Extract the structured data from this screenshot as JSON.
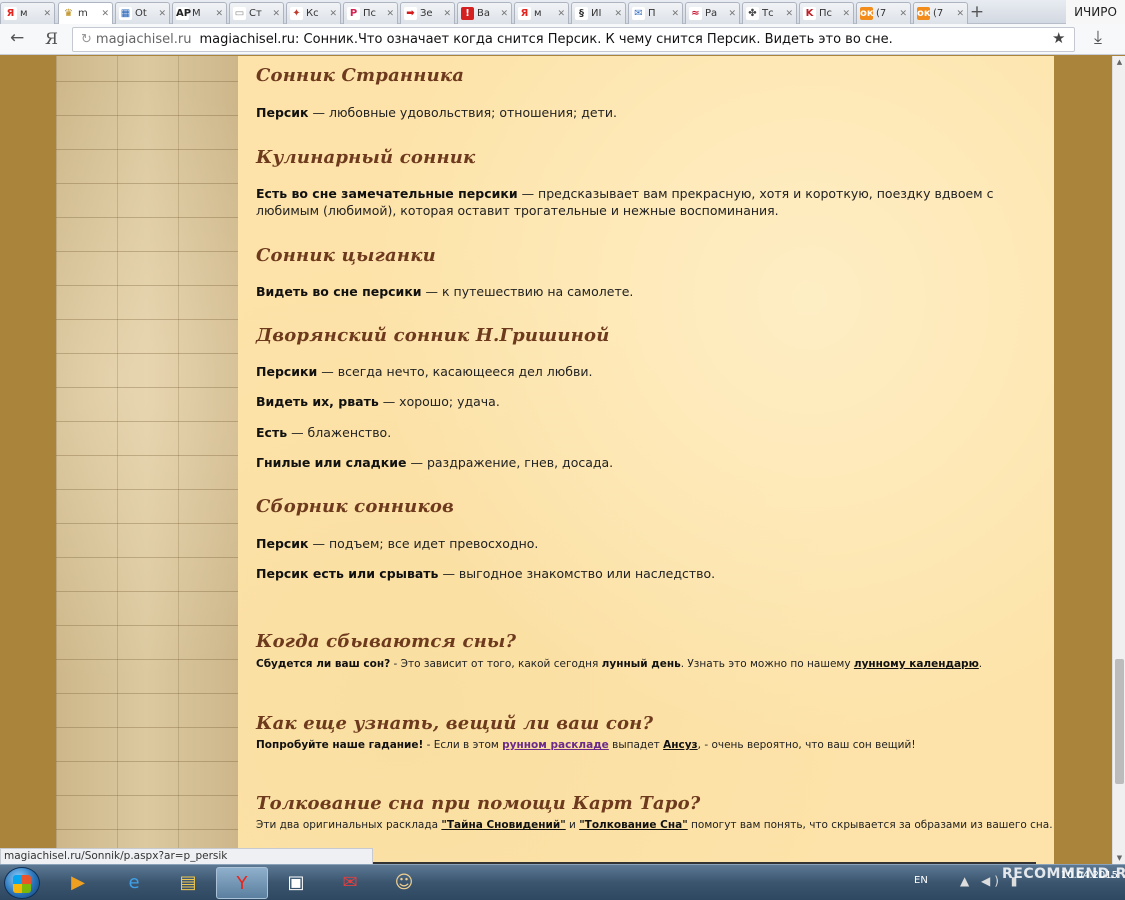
{
  "browser": {
    "tabs": [
      {
        "icon": "Я",
        "icon_bg": "#ffffff",
        "icon_color": "#e52620",
        "label": "м",
        "active": false
      },
      {
        "icon": "♛",
        "icon_bg": "#ffffff",
        "icon_color": "#b8860b",
        "label": "m",
        "active": true
      },
      {
        "icon": "▦",
        "icon_bg": "#ffffff",
        "icon_color": "#1f5fb5",
        "label": "Ot",
        "active": false
      },
      {
        "icon": "AP",
        "icon_bg": "#ffffff",
        "icon_color": "#222222",
        "label": "M",
        "active": false
      },
      {
        "icon": "▭",
        "icon_bg": "#ffffff",
        "icon_color": "#888888",
        "label": "Ст",
        "active": false
      },
      {
        "icon": "✦",
        "icon_bg": "#ffffff",
        "icon_color": "#c0392b",
        "label": "Кс",
        "active": false
      },
      {
        "icon": "P",
        "icon_bg": "#ffffff",
        "icon_color": "#d62050",
        "label": "Пс",
        "active": false
      },
      {
        "icon": "➡",
        "icon_bg": "#ffffff",
        "icon_color": "#d41a1a",
        "label": "Зе",
        "active": false
      },
      {
        "icon": "!",
        "icon_bg": "#d42020",
        "icon_color": "#ffffff",
        "label": "Ва",
        "active": false
      },
      {
        "icon": "Я",
        "icon_bg": "#ffffff",
        "icon_color": "#e52620",
        "label": "м",
        "active": false
      },
      {
        "icon": "§",
        "icon_bg": "#ffffff",
        "icon_color": "#333333",
        "label": "ИІ",
        "active": false
      },
      {
        "icon": "✉",
        "icon_bg": "#ffffff",
        "icon_color": "#3a73c4",
        "label": "П",
        "active": false
      },
      {
        "icon": "≈",
        "icon_bg": "#ffffff",
        "icon_color": "#c8102e",
        "label": "Ра",
        "active": false
      },
      {
        "icon": "✤",
        "icon_bg": "#ffffff",
        "icon_color": "#444444",
        "label": "Тс",
        "active": false
      },
      {
        "icon": "K",
        "icon_bg": "#ffffff",
        "icon_color": "#c0202a",
        "label": "Пс",
        "active": false
      },
      {
        "icon": "ок",
        "icon_bg": "#f28c1b",
        "icon_color": "#ffffff",
        "label": "(7",
        "active": false
      },
      {
        "icon": "ок",
        "icon_bg": "#f28c1b",
        "icon_color": "#ffffff",
        "label": "(7",
        "active": false
      }
    ],
    "new_tab": "+",
    "profile_label": "ИЧИРО",
    "back_icon": "←",
    "yandex_icon": "Я",
    "address": {
      "domain": "magiachisel.ru",
      "page_title": "magiachisel.ru: Сонник.Что означает когда снится Персик. К чему снится Персик. Видеть это во сне."
    },
    "star_icon": "★",
    "download_icon": "⤓",
    "status_url": "magiachisel.ru/Sonnik/p.aspx?ar=p_persik"
  },
  "sections": [
    {
      "title": "Сонник Странника",
      "entries": [
        {
          "term": "Персик",
          "text": " — любовные удовольствия; отношения; дети."
        }
      ]
    },
    {
      "title": "Кулинарный сонник",
      "entries": [
        {
          "term": "Есть во сне замечательные персики",
          "text": " — предсказывает вам прекрасную, хотя и короткую, поездку вдвоем с любимым (любимой), которая оставит трогательные и нежные воспоминания."
        }
      ]
    },
    {
      "title": "Сонник цыганки",
      "entries": [
        {
          "term": "Видеть во сне персики",
          "text": " — к путешествию на самолете."
        }
      ]
    },
    {
      "title": "Дворянский сонник Н.Гришиной",
      "entries": [
        {
          "term": "Персики",
          "text": " — всегда нечто, касающееся дел любви."
        },
        {
          "term": "Видеть их, рвать",
          "text": " — хорошо; удача."
        },
        {
          "term": "Есть",
          "text": " — блаженство."
        },
        {
          "term": "Гнилые или сладкие",
          "text": " — раздражение, гнев, досада."
        }
      ]
    },
    {
      "title": "Сборник сонников",
      "entries": [
        {
          "term": "Персик",
          "text": " — подъем; все идет превосходно."
        },
        {
          "term": "Персик есть или срывать",
          "text": " — выгодное знакомство или наследство."
        }
      ]
    }
  ],
  "promos": [
    {
      "title": "Когда сбываются сны?",
      "lead": "Сбудется ли ваш сон?",
      "t1": " - Это зависит от того, какой сегодня ",
      "bold": "лунный день",
      "t2": ". Узнать это можно по нашему ",
      "link": "лунному календарю",
      "t3": "."
    },
    {
      "title": "Как еще узнать, вещий ли ваш сон?",
      "lead": "Попробуйте наше гадание!",
      "t1": " - Если в этом ",
      "link1": "рунном раскладе",
      "t2": " выпадет ",
      "link2": "Ансуз",
      "t3": ", - очень вероятно, что ваш сон вещий!"
    },
    {
      "title": "Толкование сна при помощи Карт Таро?",
      "t1": "Эти два оригинальных расклада ",
      "link1": "\"Тайна Сновидений\"",
      "t2": " и ",
      "link2": "\"Толкование Сна\"",
      "t3": " помогут вам понять, что скрывается за образами из вашего сна."
    }
  ],
  "taskbar": {
    "apps": [
      {
        "icon": "▶",
        "color": "#f0a020"
      },
      {
        "icon": "e",
        "color": "#3fa0e8"
      },
      {
        "icon": "▤",
        "color": "#f0c850"
      },
      {
        "icon": "Y",
        "color": "#e52620"
      },
      {
        "icon": "▣",
        "color": "#ffffff"
      },
      {
        "icon": "✉",
        "color": "#e04040"
      },
      {
        "icon": "☺",
        "color": "#f0d090"
      }
    ],
    "language": "EN",
    "tray": "▲ ◀) ▮",
    "time": "",
    "date": "10.04.2015"
  },
  "watermark": "RECOMMEND.RU",
  "colors": {
    "title": "#6e3a1e",
    "paper": "#fde3a9",
    "wall": "#d6c296",
    "border": "#a9843a"
  }
}
